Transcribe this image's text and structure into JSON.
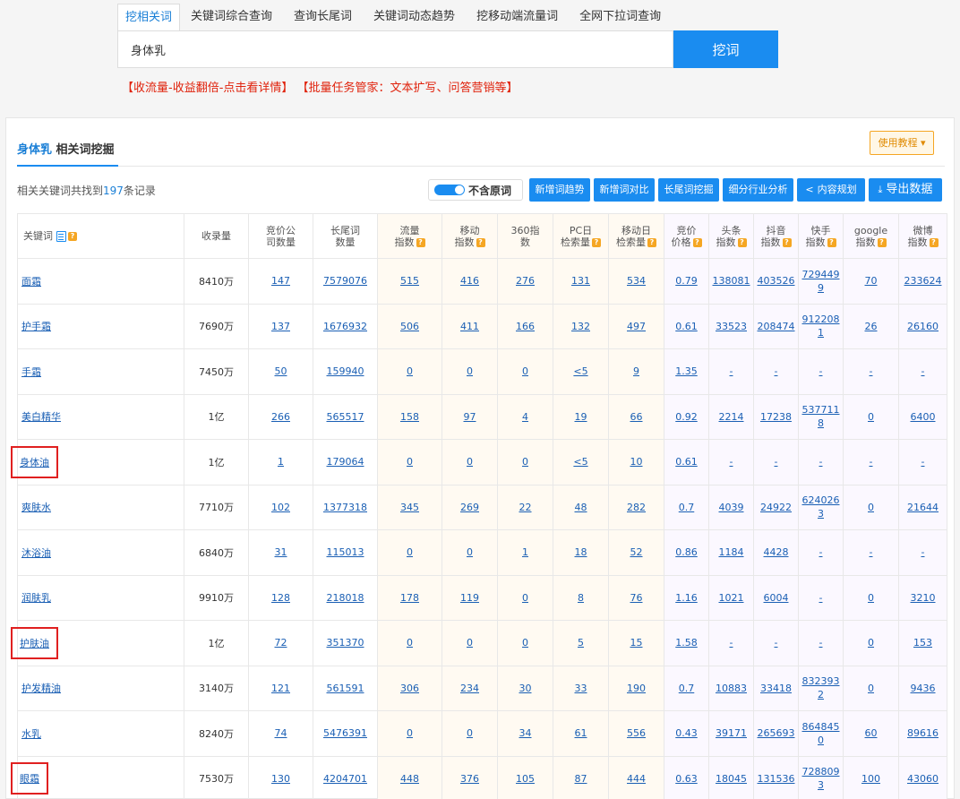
{
  "tabs": [
    "挖相关词",
    "关键词综合查询",
    "查询长尾词",
    "关键词动态趋势",
    "挖移动端流量词",
    "全网下拉词查询"
  ],
  "search": {
    "value": "身体乳",
    "button": "挖词"
  },
  "promo": {
    "left": "【收流量-收益翻倍-点击看详情】",
    "right": "【批量任务管家：文本扩写、问答营销等】"
  },
  "panel": {
    "title_kw": "身体乳",
    "title_rest": " 相关词挖掘",
    "help": "使用教程 ▾",
    "count_pre": "相关关键词共找到",
    "count_num": "197",
    "count_post": "条记录",
    "toggle_label": "不含原词",
    "buttons": [
      "新增词趋势",
      "新增词对比",
      "长尾词挖掘",
      "细分行业分析",
      "内容规划",
      "导出数据"
    ]
  },
  "columns": [
    {
      "l1": "关键词",
      "l2": ""
    },
    {
      "l1": "收录量",
      "l2": ""
    },
    {
      "l1": "竞价公",
      "l2": "司数量"
    },
    {
      "l1": "长尾词",
      "l2": "数量"
    },
    {
      "l1": "流量",
      "l2": "指数"
    },
    {
      "l1": "移动",
      "l2": "指数"
    },
    {
      "l1": "360指",
      "l2": "数"
    },
    {
      "l1": "PC日",
      "l2": "检索量"
    },
    {
      "l1": "移动日",
      "l2": "检索量"
    },
    {
      "l1": "竞价",
      "l2": "价格"
    },
    {
      "l1": "头条",
      "l2": "指数"
    },
    {
      "l1": "抖音",
      "l2": "指数"
    },
    {
      "l1": "快手",
      "l2": "指数"
    },
    {
      "l1": "google",
      "l2": "指数"
    },
    {
      "l1": "微博",
      "l2": "指数"
    }
  ],
  "rows": [
    {
      "kw": "面霜",
      "shoulu": "8410万",
      "jj": "147",
      "cw": "7579076",
      "ll": "515",
      "yd": "416",
      "s360": "276",
      "pc": "131",
      "ydr": "534",
      "price": "0.79",
      "tt": "138081",
      "dy": "403526",
      "ks": "7294499",
      "gg": "70",
      "wb": "233624",
      "hl": false
    },
    {
      "kw": "护手霜",
      "shoulu": "7690万",
      "jj": "137",
      "cw": "1676932",
      "ll": "506",
      "yd": "411",
      "s360": "166",
      "pc": "132",
      "ydr": "497",
      "price": "0.61",
      "tt": "33523",
      "dy": "208474",
      "ks": "9122081",
      "gg": "26",
      "wb": "26160",
      "hl": false
    },
    {
      "kw": "手霜",
      "shoulu": "7450万",
      "jj": "50",
      "cw": "159940",
      "ll": "0",
      "yd": "0",
      "s360": "0",
      "pc": "<5",
      "ydr": "9",
      "price": "1.35",
      "tt": "-",
      "dy": "-",
      "ks": "-",
      "gg": "-",
      "wb": "-",
      "hl": false
    },
    {
      "kw": "美白精华",
      "shoulu": "1亿",
      "jj": "266",
      "cw": "565517",
      "ll": "158",
      "yd": "97",
      "s360": "4",
      "pc": "19",
      "ydr": "66",
      "price": "0.92",
      "tt": "2214",
      "dy": "17238",
      "ks": "5377118",
      "gg": "0",
      "wb": "6400",
      "hl": false
    },
    {
      "kw": "身体油",
      "shoulu": "1亿",
      "jj": "1",
      "cw": "179064",
      "ll": "0",
      "yd": "0",
      "s360": "0",
      "pc": "<5",
      "ydr": "10",
      "price": "0.61",
      "tt": "-",
      "dy": "-",
      "ks": "-",
      "gg": "-",
      "wb": "-",
      "hl": true
    },
    {
      "kw": "爽肤水",
      "shoulu": "7710万",
      "jj": "102",
      "cw": "1377318",
      "ll": "345",
      "yd": "269",
      "s360": "22",
      "pc": "48",
      "ydr": "282",
      "price": "0.7",
      "tt": "4039",
      "dy": "24922",
      "ks": "6240263",
      "gg": "0",
      "wb": "21644",
      "hl": false
    },
    {
      "kw": "沐浴油",
      "shoulu": "6840万",
      "jj": "31",
      "cw": "115013",
      "ll": "0",
      "yd": "0",
      "s360": "1",
      "pc": "18",
      "ydr": "52",
      "price": "0.86",
      "tt": "1184",
      "dy": "4428",
      "ks": "-",
      "gg": "-",
      "wb": "-",
      "hl": false
    },
    {
      "kw": "润肤乳",
      "shoulu": "9910万",
      "jj": "128",
      "cw": "218018",
      "ll": "178",
      "yd": "119",
      "s360": "0",
      "pc": "8",
      "ydr": "76",
      "price": "1.16",
      "tt": "1021",
      "dy": "6004",
      "ks": "-",
      "gg": "0",
      "wb": "3210",
      "hl": false
    },
    {
      "kw": "护肤油",
      "shoulu": "1亿",
      "jj": "72",
      "cw": "351370",
      "ll": "0",
      "yd": "0",
      "s360": "0",
      "pc": "5",
      "ydr": "15",
      "price": "1.58",
      "tt": "-",
      "dy": "-",
      "ks": "-",
      "gg": "0",
      "wb": "153",
      "hl": true
    },
    {
      "kw": "护发精油",
      "shoulu": "3140万",
      "jj": "121",
      "cw": "561591",
      "ll": "306",
      "yd": "234",
      "s360": "30",
      "pc": "33",
      "ydr": "190",
      "price": "0.7",
      "tt": "10883",
      "dy": "33418",
      "ks": "8323932",
      "gg": "0",
      "wb": "9436",
      "hl": false
    },
    {
      "kw": "水乳",
      "shoulu": "8240万",
      "jj": "74",
      "cw": "5476391",
      "ll": "0",
      "yd": "0",
      "s360": "34",
      "pc": "61",
      "ydr": "556",
      "price": "0.43",
      "tt": "39171",
      "dy": "265693",
      "ks": "8648450",
      "gg": "60",
      "wb": "89616",
      "hl": false
    },
    {
      "kw": "眼霜",
      "shoulu": "7530万",
      "jj": "130",
      "cw": "4204701",
      "ll": "448",
      "yd": "376",
      "s360": "105",
      "pc": "87",
      "ydr": "444",
      "price": "0.63",
      "tt": "18045",
      "dy": "131536",
      "ks": "7288093",
      "gg": "100",
      "wb": "43060",
      "hl": true
    }
  ]
}
